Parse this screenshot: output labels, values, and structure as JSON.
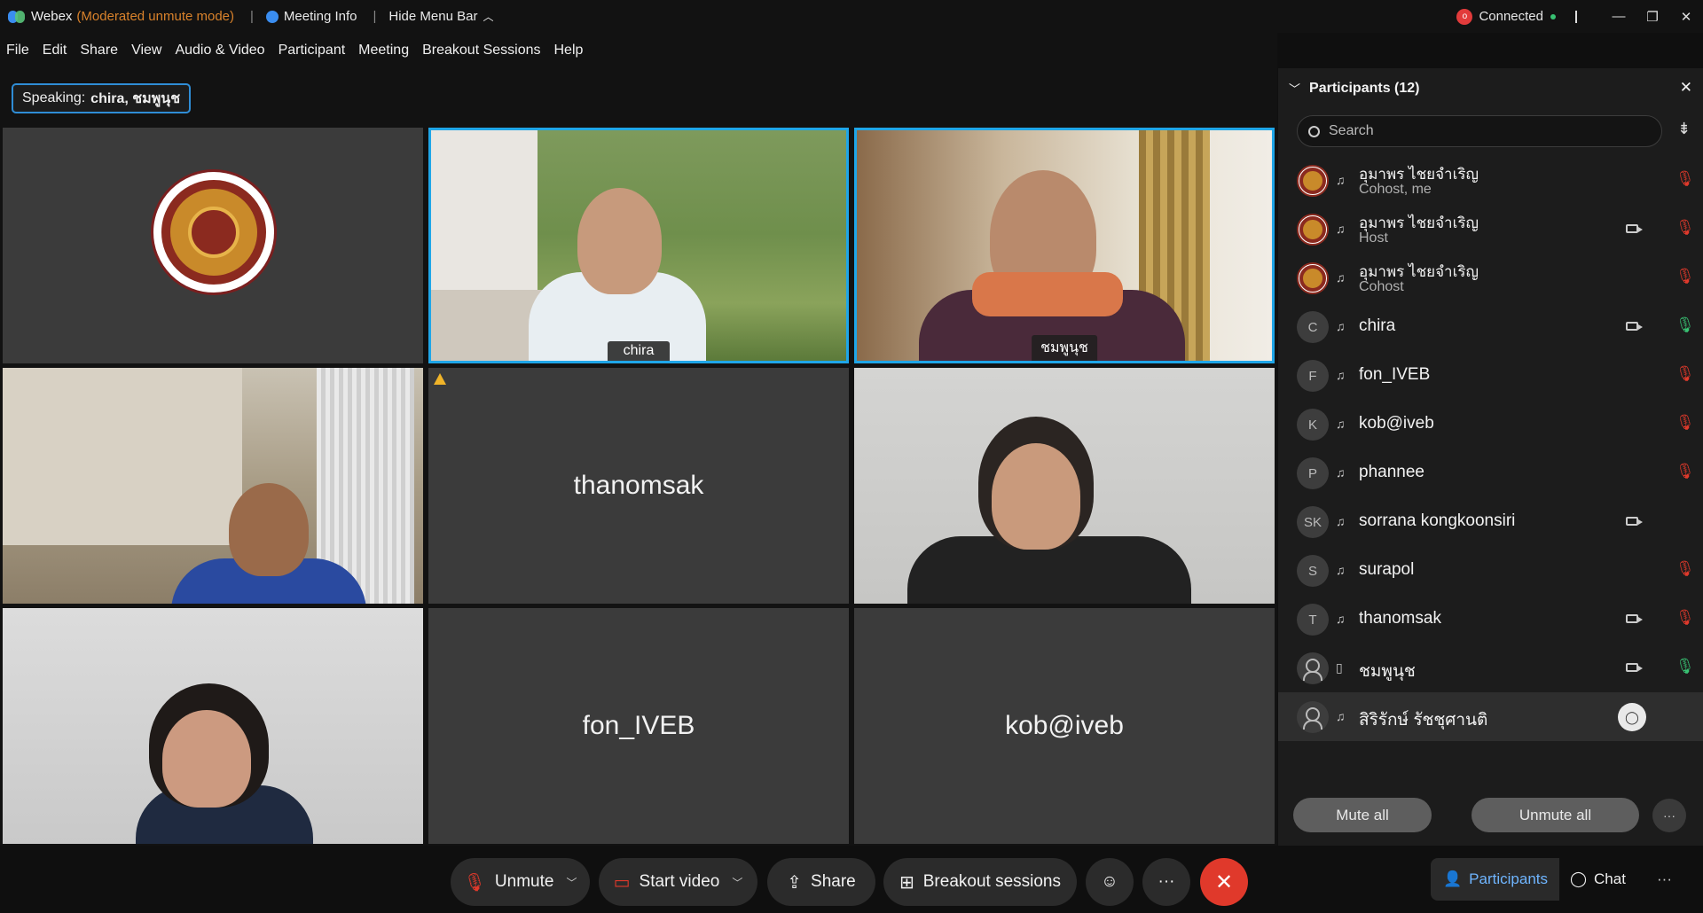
{
  "titlebar": {
    "app_name": "Webex",
    "mode": "(Moderated unmute mode)",
    "meeting_info": "Meeting Info",
    "hide_menu_bar": "Hide Menu Bar",
    "connection_status": "Connected",
    "status_badge": "o"
  },
  "menu": [
    "File",
    "Edit",
    "Share",
    "View",
    "Audio & Video",
    "Participant",
    "Meeting",
    "Breakout Sessions",
    "Help"
  ],
  "speaking": {
    "prefix": "Speaking:",
    "names": "chira, ชมพูนุช"
  },
  "tiles": [
    {
      "id": "logo",
      "name": ""
    },
    {
      "id": "chira",
      "name": "chira"
    },
    {
      "id": "chomphunut",
      "name": "ชมพูนุช"
    },
    {
      "id": "video-man",
      "name": ""
    },
    {
      "id": "thanomsak",
      "name": "thanomsak"
    },
    {
      "id": "video-woman",
      "name": ""
    },
    {
      "id": "video-woman2",
      "name": ""
    },
    {
      "id": "fon",
      "name": "fon_IVEB"
    },
    {
      "id": "kob",
      "name": "kob@iveb"
    }
  ],
  "participants_panel": {
    "title": "Participants (12)",
    "search_placeholder": "Search",
    "mute_all": "Mute all",
    "unmute_all": "Unmute all",
    "participants": [
      {
        "name": "อุมาพร ไชยจำเริญ",
        "role": "Cohost, me",
        "avatar": "seal",
        "video": false,
        "mic": "muted"
      },
      {
        "name": "อุมาพร ไชยจำเริญ",
        "role": "Host",
        "avatar": "seal",
        "video": true,
        "mic": "muted"
      },
      {
        "name": "อุมาพร ไชยจำเริญ",
        "role": "Cohost",
        "avatar": "seal",
        "video": false,
        "mic": "muted"
      },
      {
        "name": "chira",
        "role": "",
        "avatar": "C",
        "video": true,
        "mic": "live"
      },
      {
        "name": "fon_IVEB",
        "role": "",
        "avatar": "F",
        "video": false,
        "mic": "muted"
      },
      {
        "name": "kob@iveb",
        "role": "",
        "avatar": "K",
        "video": false,
        "mic": "muted"
      },
      {
        "name": "phannee",
        "role": "",
        "avatar": "P",
        "video": false,
        "mic": "muted"
      },
      {
        "name": "sorrana kongkoonsiri",
        "role": "",
        "avatar": "SK",
        "video": true,
        "mic": "none"
      },
      {
        "name": "surapol",
        "role": "",
        "avatar": "S",
        "video": false,
        "mic": "muted"
      },
      {
        "name": "thanomsak",
        "role": "",
        "avatar": "T",
        "video": true,
        "mic": "muted"
      },
      {
        "name": "ชมพูนุช",
        "role": "",
        "avatar": "person",
        "video": true,
        "mic": "live"
      },
      {
        "name": "สิริรักษ์ รัชชุศานติ",
        "role": "",
        "avatar": "person",
        "video": false,
        "mic": "chat"
      }
    ]
  },
  "controls": {
    "unmute": "Unmute",
    "start_video": "Start video",
    "share": "Share",
    "breakout": "Breakout sessions",
    "participants_tab": "Participants",
    "chat_tab": "Chat"
  },
  "colors": {
    "accent": "#1fa6e8",
    "end_call": "#e0392b",
    "muted": "#e0392b",
    "live": "#38c172",
    "mode": "#d9822b"
  }
}
